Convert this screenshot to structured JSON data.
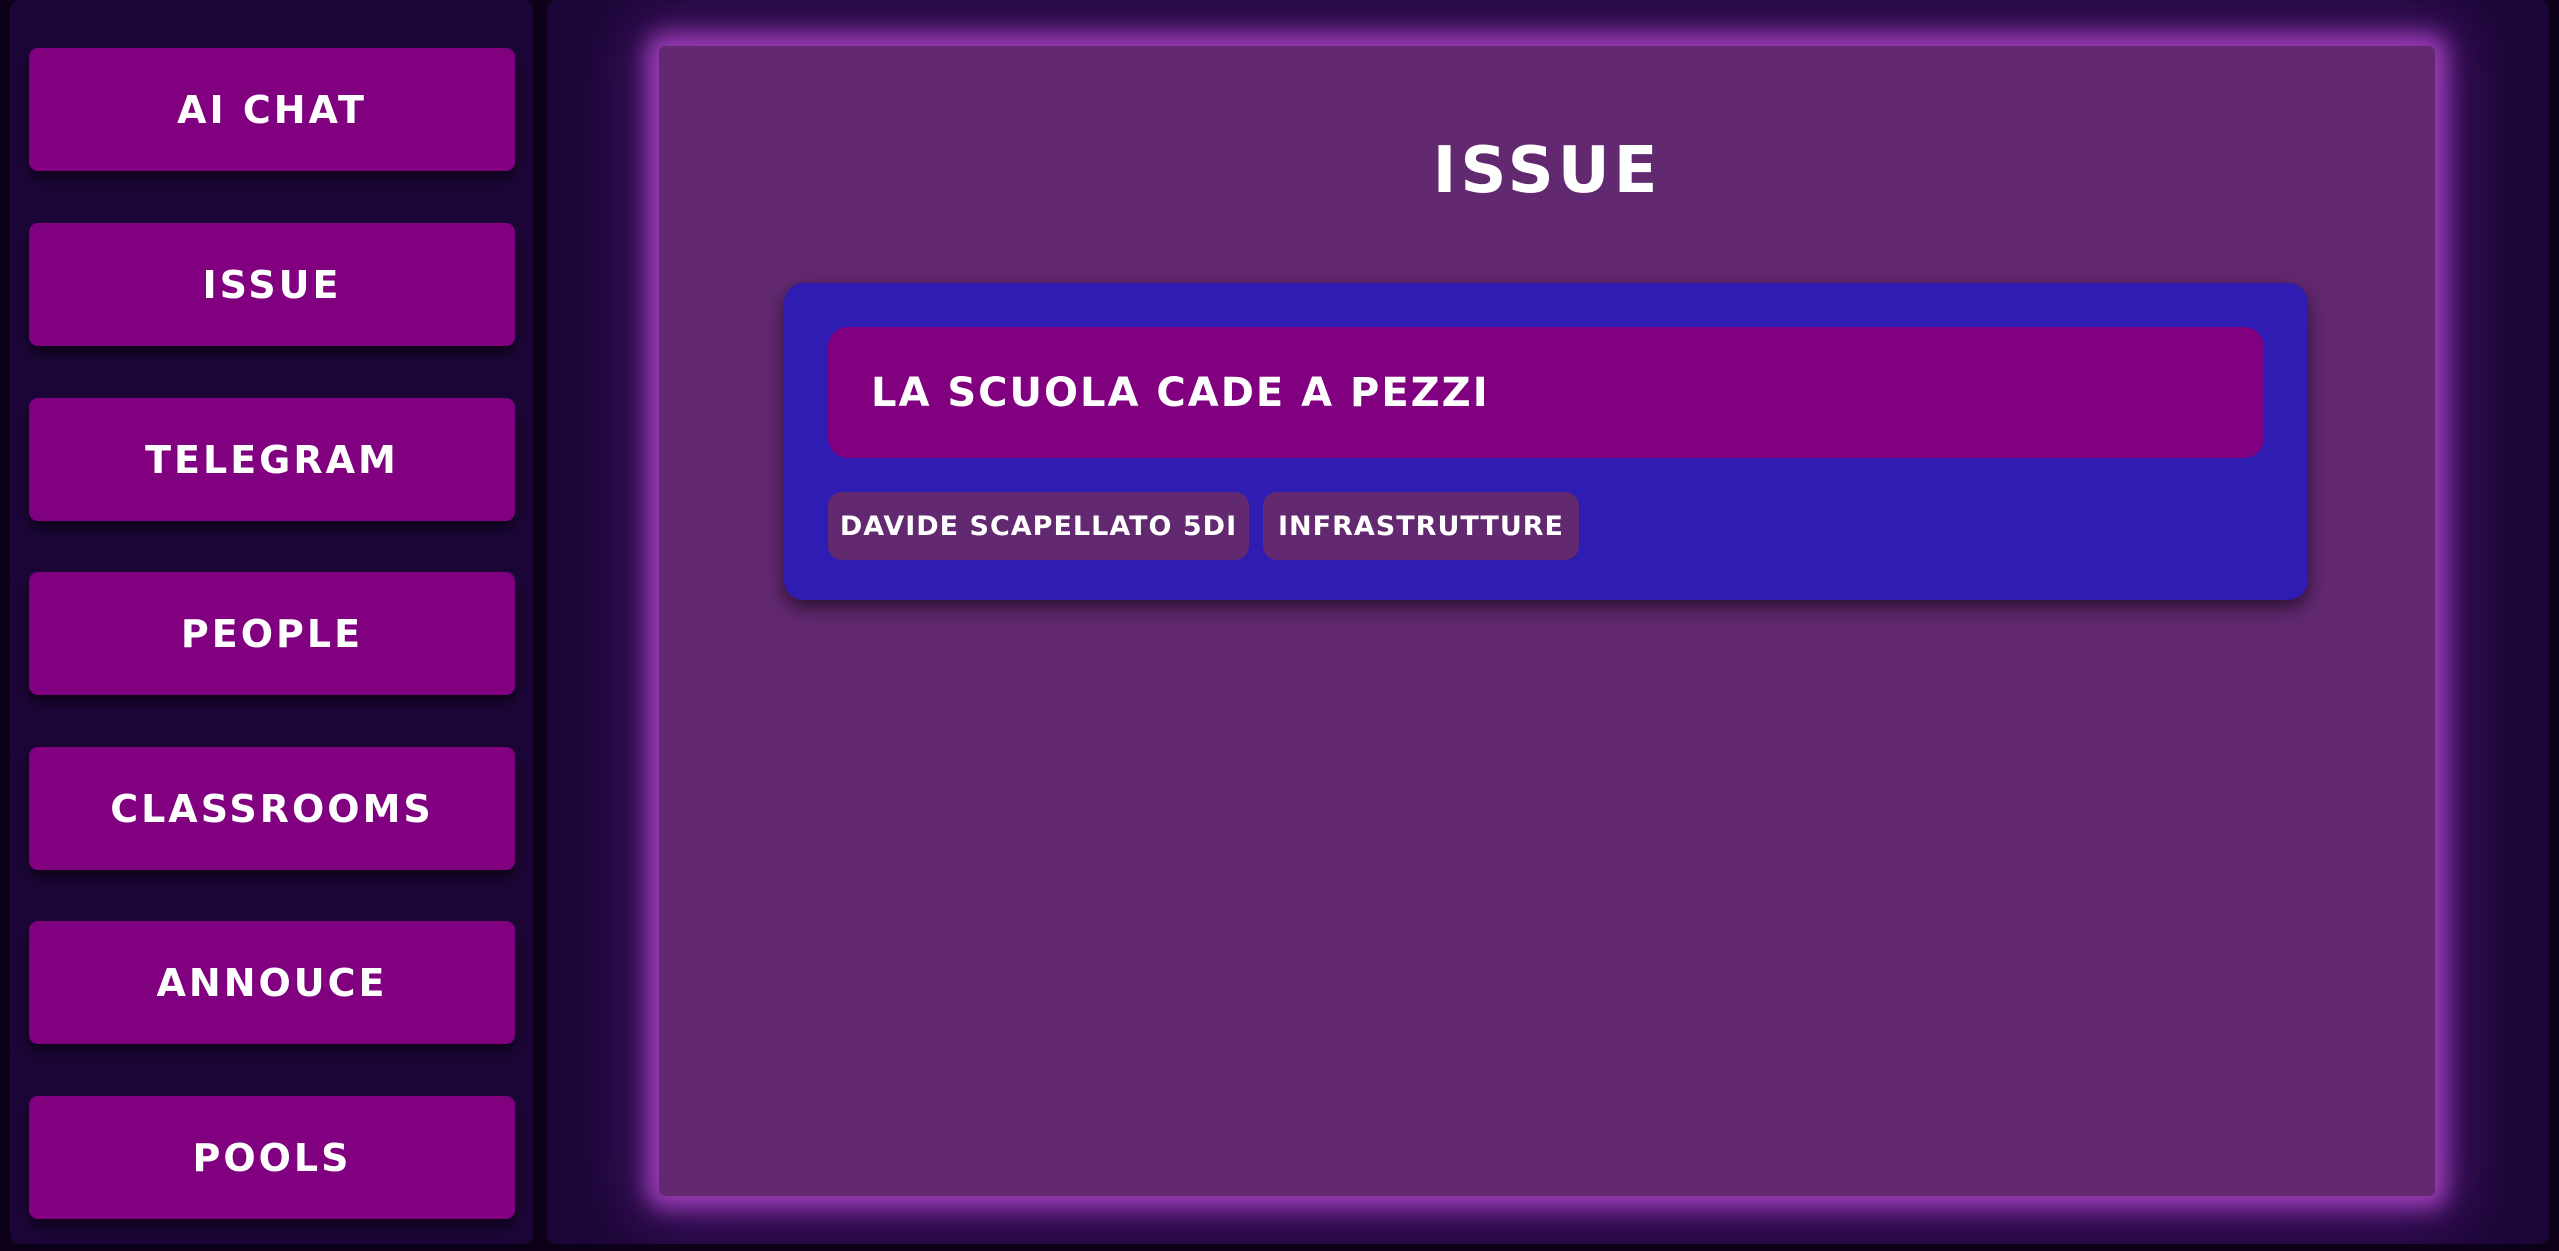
{
  "sidebar": {
    "items": [
      {
        "label": "AI CHAT"
      },
      {
        "label": "ISSUE"
      },
      {
        "label": "TELEGRAM"
      },
      {
        "label": "PEOPLE"
      },
      {
        "label": "CLASSROOMS"
      },
      {
        "label": "ANNOUCE"
      },
      {
        "label": "POOLS"
      }
    ]
  },
  "main": {
    "title": "ISSUE",
    "issues": [
      {
        "title": "LA SCUOLA CADE A PEZZI",
        "author": "DAVIDE SCAPELLATO 5DI",
        "category": "INFRASTRUTTURE"
      }
    ]
  },
  "colors": {
    "page_background": "#0c0118",
    "sidebar_background": "#1c0638",
    "nav_button": "#800080",
    "panel_background": "#622870",
    "panel_glow": "#af46c8",
    "issue_card": "#2f1cb3",
    "issue_title_box": "#800080",
    "tag_background": "#622870",
    "text": "#ffffff"
  }
}
